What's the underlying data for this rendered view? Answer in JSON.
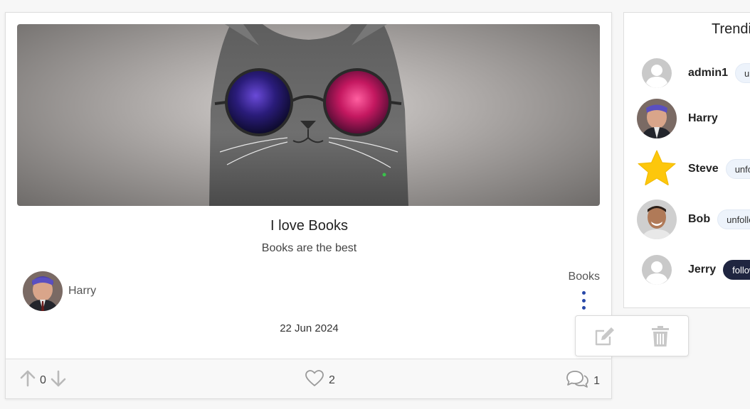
{
  "post": {
    "title": "I love Books",
    "description": "Books are the best",
    "author": "Harry",
    "category": "Books",
    "date": "22 Jun 2024",
    "votes": "0",
    "likes": "2",
    "comments": "1"
  },
  "trending": {
    "title": "Trending",
    "users": [
      {
        "name": "admin1",
        "avatar": "default-avatar-icon",
        "button": "unfollow"
      },
      {
        "name": "Harry",
        "avatar": "harry-avatar",
        "button": ""
      },
      {
        "name": "Steve",
        "avatar": "star-icon",
        "button": "unfollow"
      },
      {
        "name": "Bob",
        "avatar": "bob-avatar",
        "button": "unfollow"
      },
      {
        "name": "Jerry",
        "avatar": "default-avatar-icon",
        "button": "follow"
      }
    ]
  },
  "icons": {
    "upvote": "arrow-up-icon",
    "downvote": "arrow-down-icon",
    "like": "heart-icon",
    "comments": "comments-icon",
    "menu": "kebab-menu-icon",
    "edit": "edit-icon",
    "delete": "trash-icon"
  },
  "colors": {
    "accent": "#2848a8",
    "follow_dark": "#1f2540",
    "pill_light": "#edf3fb",
    "star": "#fdc70c"
  }
}
